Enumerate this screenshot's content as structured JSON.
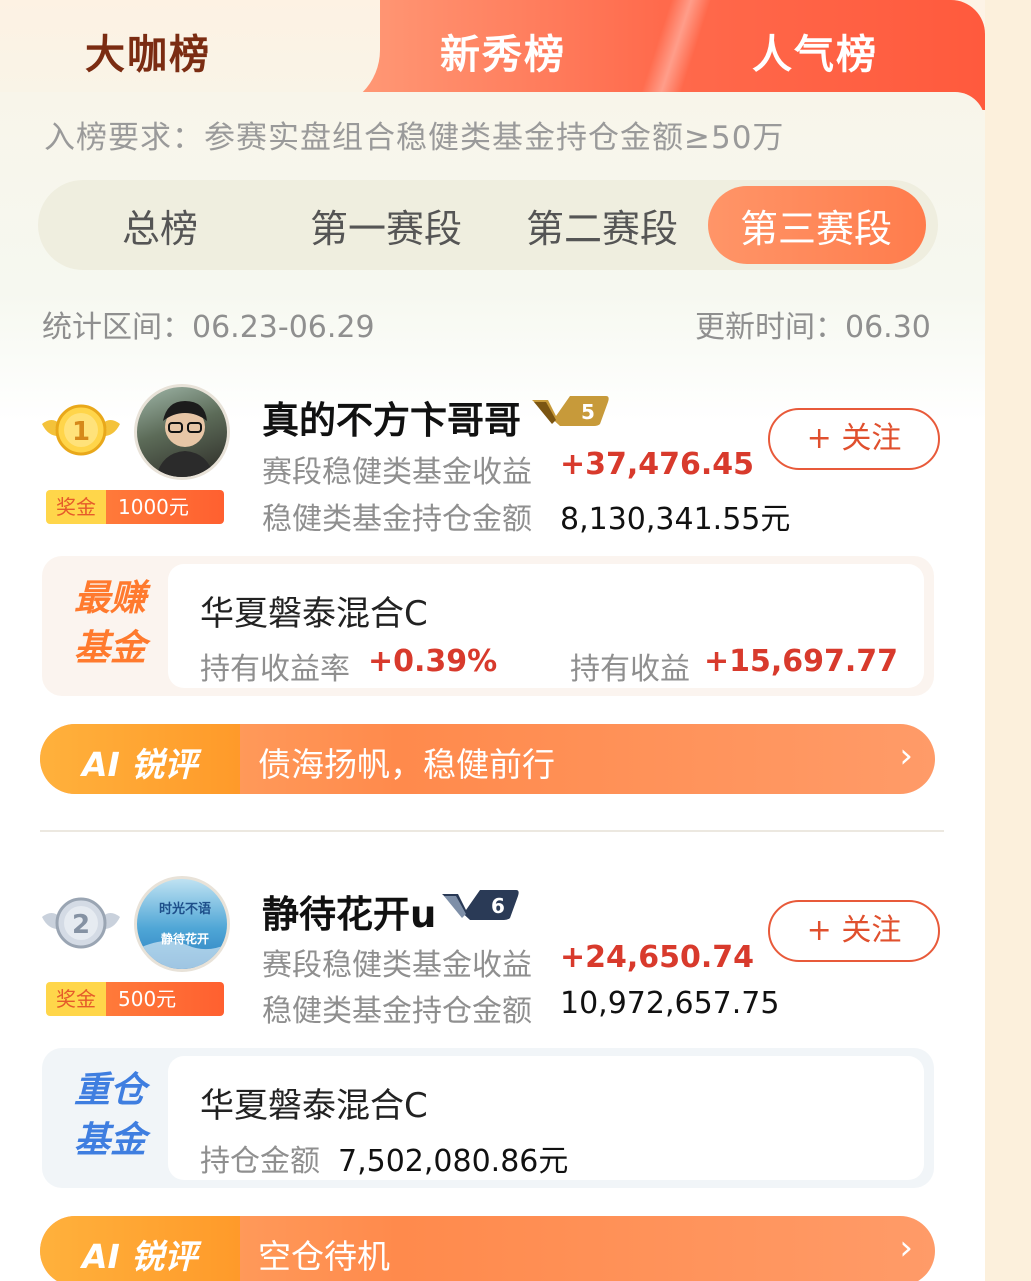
{
  "top_tabs": [
    {
      "label": "大咖榜",
      "active": true
    },
    {
      "label": "新秀榜",
      "active": false
    },
    {
      "label": "人气榜",
      "active": false
    }
  ],
  "requirement": "入榜要求：参赛实盘组合稳健类基金持仓金额≥50万",
  "segments": [
    {
      "label": "总榜"
    },
    {
      "label": "第一赛段"
    },
    {
      "label": "第二赛段"
    },
    {
      "label": "第三赛段",
      "active": true
    }
  ],
  "stat_period": "统计区间：06.23-06.29",
  "update_time": "更新时间：06.30",
  "entries": [
    {
      "rank": "1",
      "name": "真的不方卞哥哥",
      "level": "5",
      "prize_key": "奖金",
      "prize_value": "1000元",
      "income_label": "赛段稳健类基金收益",
      "income_value": "+37,476.45",
      "holding_label": "稳健类基金持仓金额",
      "holding_value": "8,130,341.55元",
      "follow_label": "+ 关注",
      "fund_tag_line1": "最赚",
      "fund_tag_line2": "基金",
      "fund_name": "华夏磐泰混合C",
      "fund_rate_label": "持有收益率",
      "fund_rate_value": "+0.39%",
      "fund_gain_label": "持有收益",
      "fund_gain_value": "+15,697.77",
      "ai_tag": "AI 锐评",
      "ai_text": "债海扬帆，稳健前行",
      "ai_arrow": "›"
    },
    {
      "rank": "2",
      "name": "静待花开u",
      "level": "6",
      "avatar_text_1": "时光不语",
      "avatar_text_2": "静待花开",
      "prize_key": "奖金",
      "prize_value": "500元",
      "income_label": "赛段稳健类基金收益",
      "income_value": "+24,650.74",
      "holding_label": "稳健类基金持仓金额",
      "holding_value": "10,972,657.75",
      "follow_label": "+ 关注",
      "fund_tag_line1": "重仓",
      "fund_tag_line2": "基金",
      "fund_name": "华夏磐泰混合C",
      "fund_hold_label": "持仓金额",
      "fund_hold_value": "7,502,080.86元",
      "ai_tag": "AI 锐评",
      "ai_text": "空仓待机",
      "ai_arrow": "›"
    }
  ],
  "colors": {
    "accent": "#ff7c4c",
    "gain_red": "#d83a2c",
    "tab_dark": "#7b2c12",
    "gold": "#ffc23a",
    "silver": "#b9c2cf",
    "blue_tag": "#3f7ee0"
  },
  "icons": {
    "medal_1": "gold-medal-icon",
    "medal_2": "silver-medal-icon",
    "level_badge": "v-level-badge-icon",
    "arrow": "chevron-right-icon"
  }
}
